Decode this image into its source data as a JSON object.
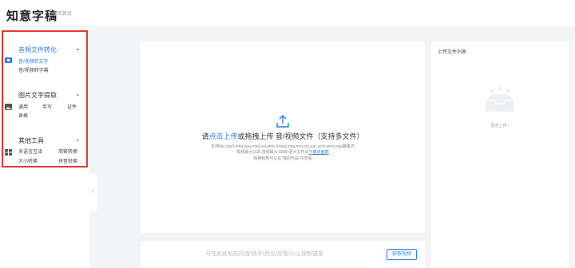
{
  "header": {
    "logo": "知意字稿",
    "home_link": "返回首页"
  },
  "sidebar": {
    "sections": [
      {
        "title": "音频文件转化",
        "items": [
          "音/视频转文字",
          "音/视频转字幕"
        ]
      },
      {
        "title": "图片文字提取",
        "items": [
          "通用",
          "手写",
          "证件",
          "表格"
        ]
      },
      {
        "title": "其他工具",
        "items": [
          "多语言互译",
          "简繁转换",
          "大小转换",
          "拼音转换"
        ]
      }
    ]
  },
  "upload": {
    "main_prefix": "请",
    "main_link": "点击上传",
    "main_suffix": "或拖拽上传 音/视频文件（支持多文件）",
    "formats": "支持flac,mp3,m4a,wav,mp4,avi,wmv,mpeg,mpg,mov,rm,aac,pcm,wma,ogg等格式",
    "limit_prefix": "视频最大1GB,音频最大100M,更大文件请",
    "limit_link": "下载桌面端",
    "result_note": "转换结果可以在\"我的作品\"中查看"
  },
  "url_bar": {
    "placeholder": "可在此处粘贴抖音/快手/西瓜/好看/火山视频链接",
    "button": "获取视频"
  },
  "file_list": {
    "title": "上传文件列表",
    "empty": "暂无上传~"
  },
  "colors": {
    "accent": "#2b7de9",
    "highlight_border": "#e53935"
  }
}
